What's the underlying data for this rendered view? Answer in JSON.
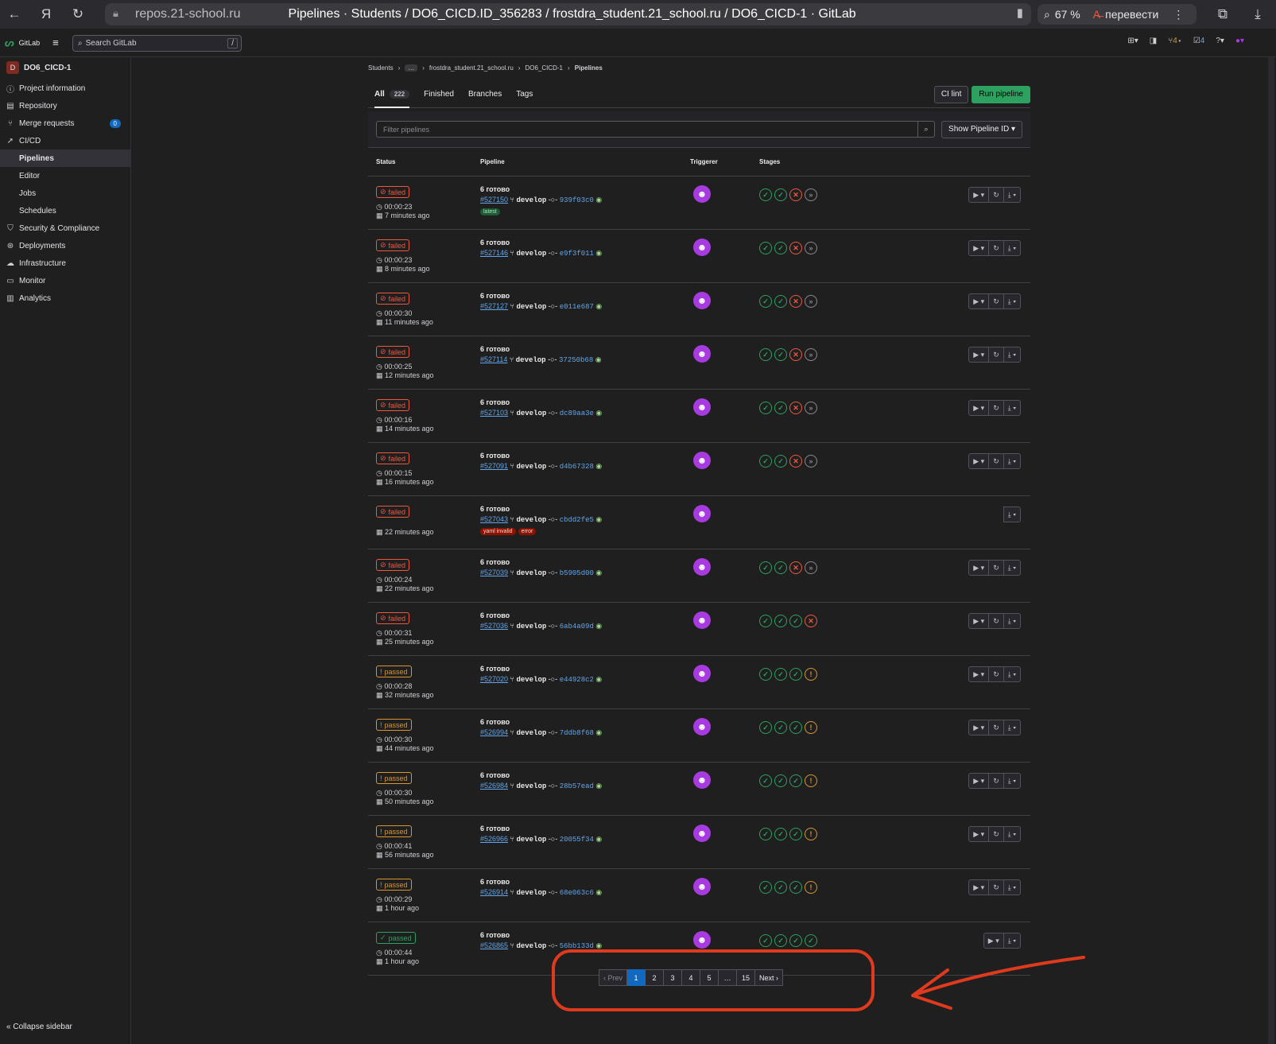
{
  "browser": {
    "url": "repos.21-school.ru",
    "page_title": "Pipelines · Students / DO6_CICD.ID_356283 / frostdra_student.21_school.ru / DO6_CICD-1 · GitLab",
    "zoom": "67 %",
    "translate": "перевести"
  },
  "header": {
    "brand": "GitLab",
    "search_placeholder": "Search GitLab",
    "search_shortcut": "/",
    "mr_count": "4",
    "todo_count": "4"
  },
  "sidebar": {
    "project_initial": "D",
    "project_name": "DO6_CICD-1",
    "items": [
      {
        "label": "Project information",
        "icon": "info-icon"
      },
      {
        "label": "Repository",
        "icon": "book-icon"
      },
      {
        "label": "Merge requests",
        "icon": "merge-icon",
        "badge": "0"
      },
      {
        "label": "CI/CD",
        "icon": "rocket-icon"
      },
      {
        "label": "Pipelines",
        "sub": true,
        "active": true
      },
      {
        "label": "Editor",
        "sub": true
      },
      {
        "label": "Jobs",
        "sub": true
      },
      {
        "label": "Schedules",
        "sub": true
      },
      {
        "label": "Security & Compliance",
        "icon": "shield-icon"
      },
      {
        "label": "Deployments",
        "icon": "deploy-icon"
      },
      {
        "label": "Infrastructure",
        "icon": "cloud-icon"
      },
      {
        "label": "Monitor",
        "icon": "monitor-icon"
      },
      {
        "label": "Analytics",
        "icon": "chart-icon"
      }
    ],
    "collapse": "Collapse sidebar"
  },
  "breadcrumb": [
    "Students",
    "…",
    "frostdra_student.21_school.ru",
    "DO6_CICD-1",
    "Pipelines"
  ],
  "tabs": {
    "all": "All",
    "all_count": "222",
    "finished": "Finished",
    "branches": "Branches",
    "tags": "Tags"
  },
  "buttons": {
    "ci_lint": "CI lint",
    "run_pipeline": "Run pipeline",
    "show_id": "Show Pipeline ID"
  },
  "filter": {
    "placeholder": "Filter pipelines"
  },
  "columns": {
    "status": "Status",
    "pipeline": "Pipeline",
    "triggerer": "Triggerer",
    "stages": "Stages"
  },
  "colors": {
    "failed": "#ec5941",
    "warning": "#d99530",
    "success": "#2da160",
    "link": "#63a6e9"
  },
  "pipelines": [
    {
      "status": "failed",
      "kind": "failed",
      "duration": "00:00:23",
      "ago": "7 minutes ago",
      "title": "6 готово",
      "id": "#527150",
      "branch": "develop",
      "sha": "939f03c0",
      "labels": [
        {
          "t": "latest",
          "c": "latest"
        }
      ],
      "stages": [
        "ok",
        "ok",
        "fail",
        "skip"
      ],
      "actions": 3
    },
    {
      "status": "failed",
      "kind": "failed",
      "duration": "00:00:23",
      "ago": "8 minutes ago",
      "title": "6 готово",
      "id": "#527146",
      "branch": "develop",
      "sha": "e9f3f011",
      "labels": [],
      "stages": [
        "ok",
        "ok",
        "fail",
        "skip"
      ],
      "actions": 3
    },
    {
      "status": "failed",
      "kind": "failed",
      "duration": "00:00:30",
      "ago": "11 minutes ago",
      "title": "6 готово",
      "id": "#527127",
      "branch": "develop",
      "sha": "e011e687",
      "labels": [],
      "stages": [
        "ok",
        "ok",
        "fail",
        "skip"
      ],
      "actions": 3
    },
    {
      "status": "failed",
      "kind": "failed",
      "duration": "00:00:25",
      "ago": "12 minutes ago",
      "title": "6 готово",
      "id": "#527114",
      "branch": "develop",
      "sha": "37250b68",
      "labels": [],
      "stages": [
        "ok",
        "ok",
        "fail",
        "skip"
      ],
      "actions": 3
    },
    {
      "status": "failed",
      "kind": "failed",
      "duration": "00:00:16",
      "ago": "14 minutes ago",
      "title": "6 готово",
      "id": "#527103",
      "branch": "develop",
      "sha": "dc89aa3e",
      "labels": [],
      "stages": [
        "ok",
        "ok",
        "fail",
        "skip"
      ],
      "actions": 3
    },
    {
      "status": "failed",
      "kind": "failed",
      "duration": "00:00:15",
      "ago": "16 minutes ago",
      "title": "6 готово",
      "id": "#527091",
      "branch": "develop",
      "sha": "d4b67328",
      "labels": [],
      "stages": [
        "ok",
        "ok",
        "fail",
        "skip"
      ],
      "actions": 3
    },
    {
      "status": "failed",
      "kind": "failed",
      "duration": "",
      "ago": "22 minutes ago",
      "title": "6 готово",
      "id": "#527043",
      "branch": "develop",
      "sha": "cbdd2fe5",
      "labels": [
        {
          "t": "yaml invalid",
          "c": "red"
        },
        {
          "t": "error",
          "c": "red"
        }
      ],
      "stages": [],
      "actions": 1
    },
    {
      "status": "failed",
      "kind": "failed",
      "duration": "00:00:24",
      "ago": "22 minutes ago",
      "title": "6 готово",
      "id": "#527039",
      "branch": "develop",
      "sha": "b5905d00",
      "labels": [],
      "stages": [
        "ok",
        "ok",
        "fail",
        "skip"
      ],
      "actions": 3
    },
    {
      "status": "failed",
      "kind": "failed",
      "duration": "00:00:31",
      "ago": "25 minutes ago",
      "title": "6 готово",
      "id": "#527036",
      "branch": "develop",
      "sha": "6ab4a09d",
      "labels": [],
      "stages": [
        "ok",
        "ok",
        "ok",
        "fail"
      ],
      "actions": 3
    },
    {
      "status": "passed",
      "kind": "warn",
      "duration": "00:00:28",
      "ago": "32 minutes ago",
      "title": "6 готово",
      "id": "#527020",
      "branch": "develop",
      "sha": "e44928c2",
      "labels": [],
      "stages": [
        "ok",
        "ok",
        "ok",
        "warn"
      ],
      "actions": 3
    },
    {
      "status": "passed",
      "kind": "warn",
      "duration": "00:00:30",
      "ago": "44 minutes ago",
      "title": "6 готово",
      "id": "#526994",
      "branch": "develop",
      "sha": "7ddb8f68",
      "labels": [],
      "stages": [
        "ok",
        "ok",
        "ok",
        "warn"
      ],
      "actions": 3
    },
    {
      "status": "passed",
      "kind": "warn",
      "duration": "00:00:30",
      "ago": "50 minutes ago",
      "title": "6 готово",
      "id": "#526984",
      "branch": "develop",
      "sha": "28b57ead",
      "labels": [],
      "stages": [
        "ok",
        "ok",
        "ok",
        "warn"
      ],
      "actions": 3
    },
    {
      "status": "passed",
      "kind": "warn",
      "duration": "00:00:41",
      "ago": "56 minutes ago",
      "title": "6 готово",
      "id": "#526966",
      "branch": "develop",
      "sha": "20055f34",
      "labels": [],
      "stages": [
        "ok",
        "ok",
        "ok",
        "warn"
      ],
      "actions": 3
    },
    {
      "status": "passed",
      "kind": "warn",
      "duration": "00:00:29",
      "ago": "1 hour ago",
      "title": "6 готово",
      "id": "#526914",
      "branch": "develop",
      "sha": "68e063c6",
      "labels": [],
      "stages": [
        "ok",
        "ok",
        "ok",
        "warn"
      ],
      "actions": 3
    },
    {
      "status": "passed",
      "kind": "ok",
      "duration": "00:00:44",
      "ago": "1 hour ago",
      "title": "6 готово",
      "id": "#526865",
      "branch": "develop",
      "sha": "56bb133d",
      "labels": [],
      "stages": [
        "ok",
        "ok",
        "ok",
        "ok"
      ],
      "actions": 2
    }
  ],
  "pagination": {
    "prev": "‹ Prev",
    "pages": [
      "1",
      "2",
      "3",
      "4",
      "5",
      "…",
      "15"
    ],
    "current": "1",
    "next": "Next ›"
  }
}
